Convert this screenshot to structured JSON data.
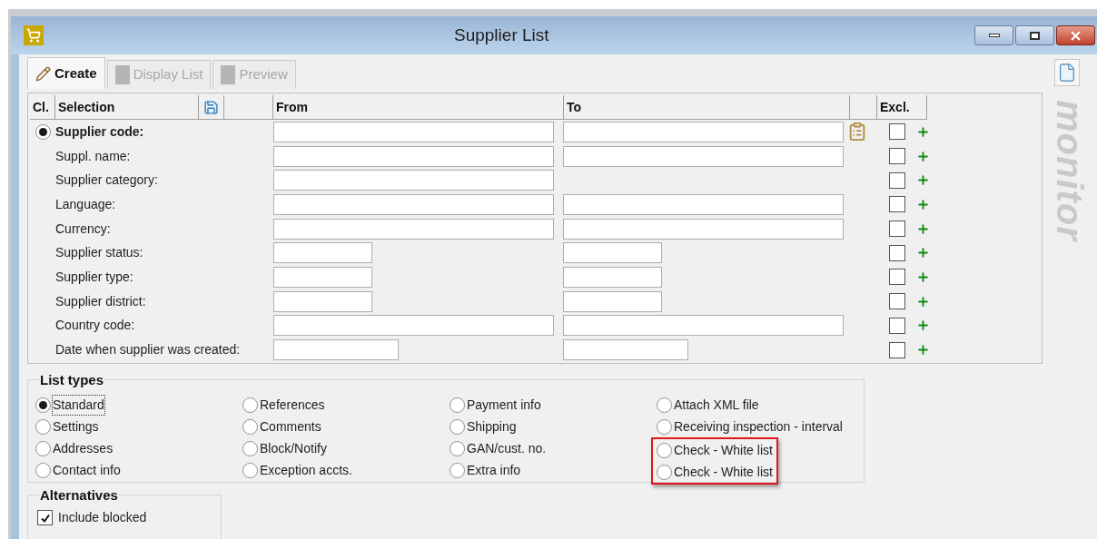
{
  "window": {
    "title": "Supplier List"
  },
  "tabs": [
    {
      "label": "Create",
      "selected": true,
      "disabled": false
    },
    {
      "label": "Display List",
      "selected": false,
      "disabled": true
    },
    {
      "label": "Preview",
      "selected": false,
      "disabled": true
    }
  ],
  "logo": "monitor",
  "selection_grid": {
    "columns": [
      "Cl.",
      "Selection",
      "From",
      "To",
      "Excl."
    ],
    "rows": [
      {
        "label": "Supplier code:",
        "selected": true,
        "from_field": {
          "kind": "long"
        },
        "to_field": {
          "kind": "long"
        },
        "paste": true,
        "excluded": false
      },
      {
        "label": "Suppl. name:",
        "from_field": {
          "kind": "long"
        },
        "to_field": {
          "kind": "long"
        },
        "paste": false,
        "excluded": false
      },
      {
        "label": "Supplier category:",
        "from_field": {
          "kind": "long"
        },
        "paste": false,
        "excluded": false
      },
      {
        "label": "Language:",
        "from_field": {
          "kind": "long"
        },
        "to_field": {
          "kind": "long"
        },
        "paste": false,
        "excluded": false
      },
      {
        "label": "Currency:",
        "from_field": {
          "kind": "long"
        },
        "to_field": {
          "kind": "long"
        },
        "paste": false,
        "excluded": false
      },
      {
        "label": "Supplier status:",
        "from_field": {
          "kind": "short"
        },
        "to_field": {
          "kind": "short"
        },
        "paste": false,
        "excluded": false
      },
      {
        "label": "Supplier type:",
        "from_field": {
          "kind": "short"
        },
        "to_field": {
          "kind": "short"
        },
        "paste": false,
        "excluded": false
      },
      {
        "label": "Supplier district:",
        "from_field": {
          "kind": "short"
        },
        "to_field": {
          "kind": "short"
        },
        "paste": false,
        "excluded": false
      },
      {
        "label": "Country code:",
        "from_field": {
          "kind": "long"
        },
        "to_field": {
          "kind": "long"
        },
        "paste": false,
        "excluded": false
      },
      {
        "label": "Date when supplier was created:",
        "from_field": {
          "kind": "date"
        },
        "to_field": {
          "kind": "date"
        },
        "paste": false,
        "excluded": false
      }
    ]
  },
  "list_types": {
    "title": "List types",
    "columns": [
      [
        {
          "label": "Standard",
          "selected": true,
          "highlighted": false
        },
        {
          "label": "Settings",
          "selected": false,
          "highlighted": false
        },
        {
          "label": "Addresses",
          "selected": false,
          "highlighted": false
        },
        {
          "label": "Contact info",
          "selected": false,
          "highlighted": false
        }
      ],
      [
        {
          "label": "References",
          "selected": false,
          "highlighted": false
        },
        {
          "label": "Comments",
          "selected": false,
          "highlighted": false
        },
        {
          "label": "Block/Notify",
          "selected": false,
          "highlighted": false
        },
        {
          "label": "Exception accts.",
          "selected": false,
          "highlighted": false
        }
      ],
      [
        {
          "label": "Payment info",
          "selected": false,
          "highlighted": false
        },
        {
          "label": "Shipping",
          "selected": false,
          "highlighted": false
        },
        {
          "label": "GAN/cust. no.",
          "selected": false,
          "highlighted": false
        },
        {
          "label": "Extra info",
          "selected": false,
          "highlighted": false
        }
      ],
      [
        {
          "label": "Attach XML file",
          "selected": false,
          "highlighted": false
        },
        {
          "label": "Receiving inspection - interval",
          "selected": false,
          "highlighted": false
        },
        {
          "label": "Check - White list",
          "selected": false,
          "highlighted": true
        },
        {
          "label": "Check - White list",
          "selected": false,
          "highlighted": true
        }
      ]
    ]
  },
  "alternatives": {
    "title": "Alternatives",
    "options": [
      {
        "label": "Include blocked",
        "checked": true
      }
    ]
  }
}
